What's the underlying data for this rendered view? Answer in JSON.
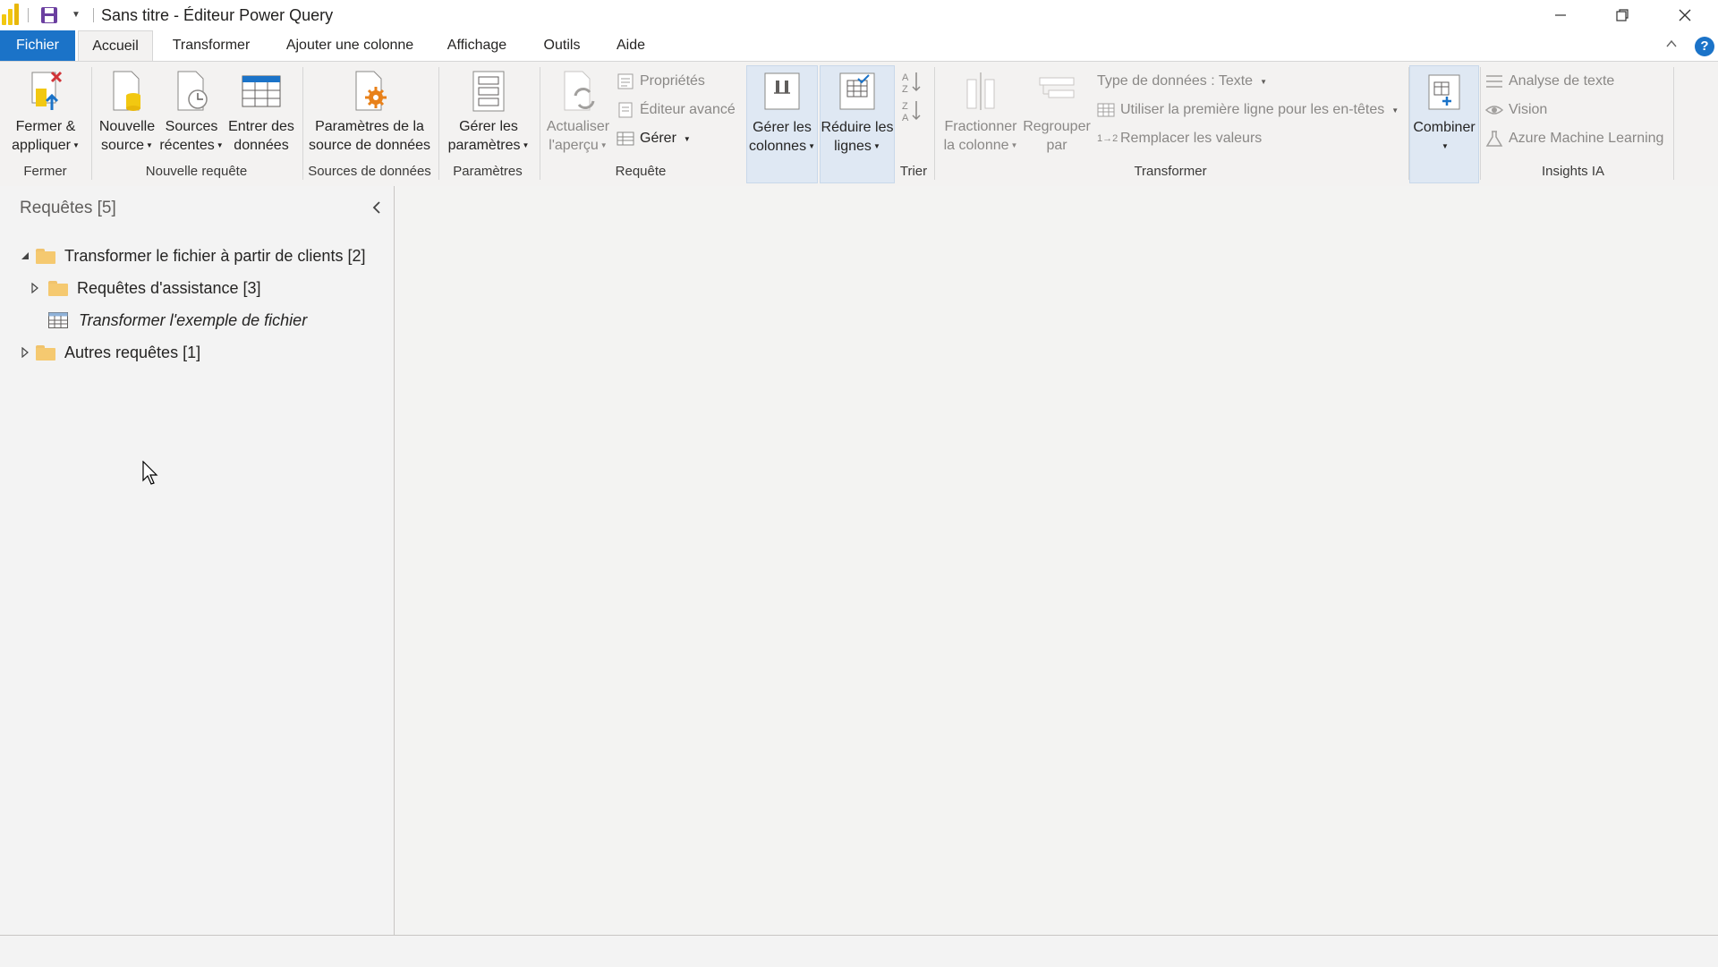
{
  "window": {
    "title": "Sans titre - Éditeur Power Query",
    "minimize": "minimize-icon",
    "restore": "restore-icon",
    "close": "close-icon"
  },
  "tabs": [
    "Fichier",
    "Accueil",
    "Transformer",
    "Ajouter une colonne",
    "Affichage",
    "Outils",
    "Aide"
  ],
  "active_tab": "Accueil",
  "help_label": "?",
  "ribbon": {
    "fermer": {
      "label": "Fermer",
      "btn_line1": "Fermer &",
      "btn_line2": "appliquer"
    },
    "nouvelle_requete": {
      "label": "Nouvelle requête",
      "nouvelle_source": [
        "Nouvelle",
        "source"
      ],
      "sources_recentes": [
        "Sources",
        "récentes"
      ],
      "entrer_donnees": [
        "Entrer des",
        "données"
      ]
    },
    "sources_donnees": {
      "label": "Sources de données",
      "btn": [
        "Paramètres de la",
        "source de données"
      ]
    },
    "parametres": {
      "label": "Paramètres",
      "btn": [
        "Gérer les",
        "paramètres"
      ]
    },
    "requete": {
      "label": "Requête",
      "actualiser": [
        "Actualiser",
        "l'aperçu"
      ],
      "proprietes": "Propriétés",
      "editeur": "Éditeur avancé",
      "gerer": "Gérer"
    },
    "gerer_colonnes": [
      "Gérer les",
      "colonnes"
    ],
    "reduire_lignes": [
      "Réduire les",
      "lignes"
    ],
    "trier": {
      "label": "Trier"
    },
    "transformer": {
      "label": "Transformer",
      "fractionner": [
        "Fractionner",
        "la colonne"
      ],
      "regrouper": [
        "Regrouper",
        "par"
      ],
      "type_donnees": "Type de données : Texte",
      "premiere_ligne": "Utiliser la première ligne pour les en-têtes",
      "remplacer": "Remplacer les valeurs",
      "remplacer_prefix": "1→2"
    },
    "combiner": "Combiner",
    "insights": {
      "label": "Insights IA",
      "analyse": "Analyse de texte",
      "vision": "Vision",
      "azure": "Azure Machine Learning"
    }
  },
  "queries": {
    "title": "Requêtes [5]",
    "tree": [
      {
        "label": "Transformer le fichier à partir de clients [2]"
      },
      {
        "label": "Requêtes d'assistance [3]"
      },
      {
        "label": "Transformer l'exemple de fichier"
      },
      {
        "label": "Autres requêtes [1]"
      }
    ]
  },
  "colors": {
    "accent": "#1b73c8",
    "folder": "#f5c970",
    "powerbi": "#f2c811"
  }
}
